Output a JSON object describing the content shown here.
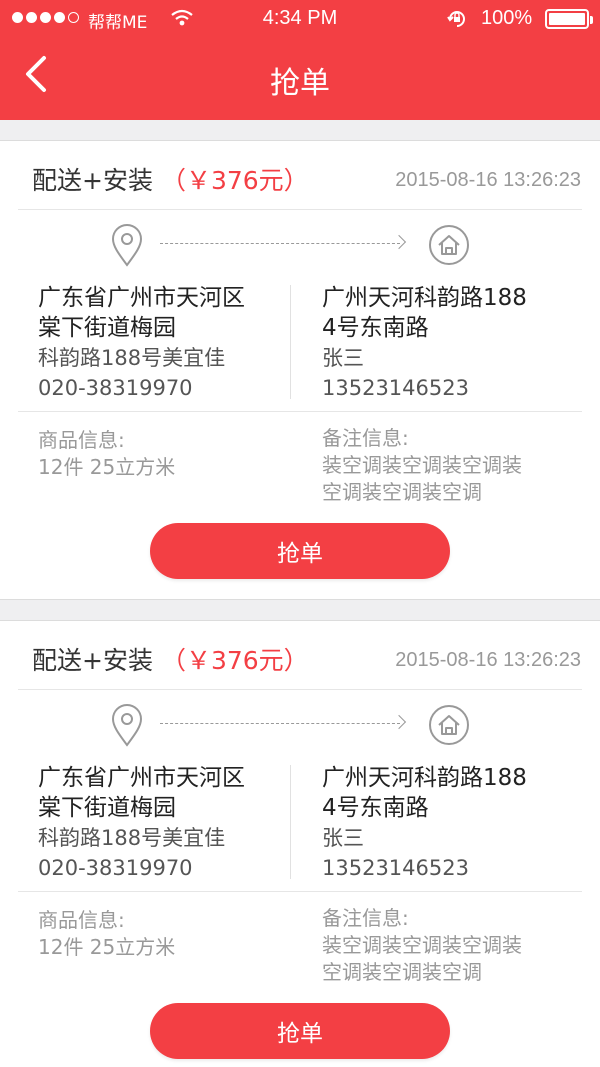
{
  "status_bar": {
    "carrier": "帮帮ME",
    "time": "4:34 PM",
    "battery": "100%"
  },
  "nav": {
    "title": "抢单",
    "back_icon": "chevron-left-icon"
  },
  "colors": {
    "brand": "#f33f44",
    "muted": "#999999"
  },
  "orders": [
    {
      "service": "配送+安装",
      "price": "（￥376元）",
      "datetime": "2015-08-16 13:26:23",
      "from": {
        "line1": "广东省广州市天河区",
        "line2": "棠下街道梅园",
        "line3": "科韵路188号美宜佳",
        "phone": "020-38319970"
      },
      "to": {
        "line1": "广州天河科韵路188",
        "line2": "4号东南路",
        "name": "张三",
        "phone": "13523146523"
      },
      "goods_label": "商品信息:",
      "goods_value": "12件  25立方米",
      "remark_label": "备注信息:",
      "remark_line1": "装空调装空调装空调装",
      "remark_line2": "空调装空调装空调",
      "button": "抢单"
    },
    {
      "service": "配送+安装",
      "price": "（￥376元）",
      "datetime": "2015-08-16 13:26:23",
      "from": {
        "line1": "广东省广州市天河区",
        "line2": "棠下街道梅园",
        "line3": "科韵路188号美宜佳",
        "phone": "020-38319970"
      },
      "to": {
        "line1": "广州天河科韵路188",
        "line2": "4号东南路",
        "name": "张三",
        "phone": "13523146523"
      },
      "goods_label": "商品信息:",
      "goods_value": "12件  25立方米",
      "remark_label": "备注信息:",
      "remark_line1": "装空调装空调装空调装",
      "remark_line2": "空调装空调装空调",
      "button": "抢单"
    }
  ]
}
